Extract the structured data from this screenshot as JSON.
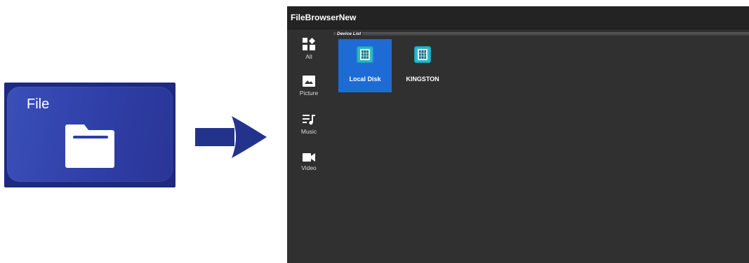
{
  "tile": {
    "label": "File"
  },
  "window": {
    "title": "FileBrowserNew",
    "sidebar": [
      {
        "label": "All",
        "icon": "dashboard-icon"
      },
      {
        "label": "Picture",
        "icon": "image-icon"
      },
      {
        "label": "Music",
        "icon": "music-list-icon"
      },
      {
        "label": "Video",
        "icon": "videocam-icon"
      }
    ],
    "section_label": "Device List",
    "devices": [
      {
        "label": "Local Disk",
        "icon": "disk-icon",
        "selected": true
      },
      {
        "label": "KINGSTON",
        "icon": "disk-icon",
        "selected": false
      }
    ]
  },
  "colors": {
    "tile": "#2f3fa7",
    "arrow": "#23338c",
    "window_bg": "#303030",
    "titlebar": "#232323",
    "selected": "#1e6bd6"
  }
}
